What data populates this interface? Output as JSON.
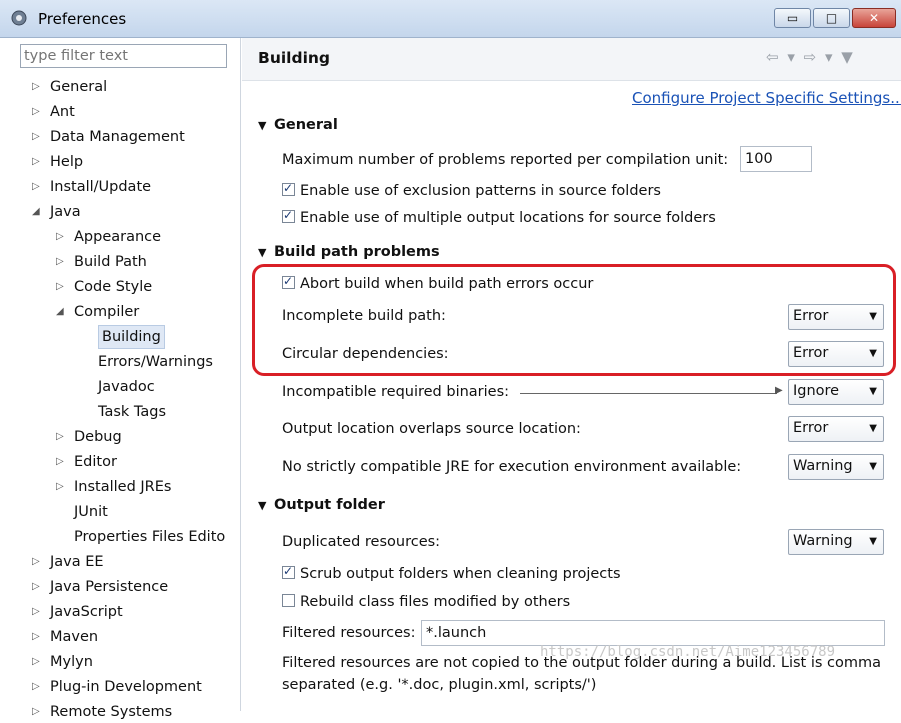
{
  "window": {
    "title": "Preferences",
    "min_glyph": "▭",
    "max_glyph": "□",
    "close_glyph": "✕"
  },
  "filter": {
    "placeholder": "type filter text"
  },
  "tree": {
    "items": [
      {
        "label": "General",
        "level": 0,
        "twisty": "▷"
      },
      {
        "label": "Ant",
        "level": 0,
        "twisty": "▷"
      },
      {
        "label": "Data Management",
        "level": 0,
        "twisty": "▷"
      },
      {
        "label": "Help",
        "level": 0,
        "twisty": "▷"
      },
      {
        "label": "Install/Update",
        "level": 0,
        "twisty": "▷"
      },
      {
        "label": "Java",
        "level": 0,
        "twisty": "◢"
      },
      {
        "label": "Appearance",
        "level": 1,
        "twisty": "▷"
      },
      {
        "label": "Build Path",
        "level": 1,
        "twisty": "▷"
      },
      {
        "label": "Code Style",
        "level": 1,
        "twisty": "▷"
      },
      {
        "label": "Compiler",
        "level": 1,
        "twisty": "◢"
      },
      {
        "label": "Building",
        "level": 2,
        "twisty": "",
        "selected": true
      },
      {
        "label": "Errors/Warnings",
        "level": 2,
        "twisty": ""
      },
      {
        "label": "Javadoc",
        "level": 2,
        "twisty": ""
      },
      {
        "label": "Task Tags",
        "level": 2,
        "twisty": ""
      },
      {
        "label": "Debug",
        "level": 1,
        "twisty": "▷"
      },
      {
        "label": "Editor",
        "level": 1,
        "twisty": "▷"
      },
      {
        "label": "Installed JREs",
        "level": 1,
        "twisty": "▷"
      },
      {
        "label": "JUnit",
        "level": 1,
        "twisty": ""
      },
      {
        "label": "Properties Files Edito",
        "level": 1,
        "twisty": ""
      },
      {
        "label": "Java EE",
        "level": 0,
        "twisty": "▷"
      },
      {
        "label": "Java Persistence",
        "level": 0,
        "twisty": "▷"
      },
      {
        "label": "JavaScript",
        "level": 0,
        "twisty": "▷"
      },
      {
        "label": "Maven",
        "level": 0,
        "twisty": "▷"
      },
      {
        "label": "Mylyn",
        "level": 0,
        "twisty": "▷"
      },
      {
        "label": "Plug-in Development",
        "level": 0,
        "twisty": "▷"
      },
      {
        "label": "Remote Systems",
        "level": 0,
        "twisty": "▷"
      }
    ]
  },
  "page": {
    "title": "Building",
    "nav_icons": "⇦ ▾ ⇨ ▾ ▼",
    "configure_link": "Configure Project Specific Settings...",
    "general": {
      "header": "General",
      "max_problems_label": "Maximum number of problems reported per compilation unit:",
      "max_problems_value": "100",
      "exclusion_label": "Enable use of exclusion patterns in source folders",
      "exclusion_checked": true,
      "multiple_output_label": "Enable use of multiple output locations for source folders",
      "multiple_output_checked": true
    },
    "build_path": {
      "header": "Build path problems",
      "abort_label": "Abort build when build path errors occur",
      "abort_checked": true,
      "incomplete_label": "Incomplete build path:",
      "incomplete_value": "Error",
      "circular_label": "Circular dependencies:",
      "circular_value": "Error",
      "incompatible_label": "Incompatible required binaries:",
      "incompatible_value": "Ignore",
      "overlap_label": "Output location overlaps source location:",
      "overlap_value": "Error",
      "jre_label": "No strictly compatible JRE for execution environment available:",
      "jre_value": "Warning"
    },
    "output": {
      "header": "Output folder",
      "duplicated_label": "Duplicated resources:",
      "duplicated_value": "Warning",
      "scrub_label": "Scrub output folders when cleaning projects",
      "scrub_checked": true,
      "rebuild_label": "Rebuild class files modified by others",
      "rebuild_checked": false,
      "filtered_label": "Filtered resources:",
      "filtered_value": "*.launch",
      "note": "Filtered resources are not copied to the output folder during a build. List is comma separated (e.g. '*.doc, plugin.xml, scripts/')"
    },
    "dropdown_glyph": "▼",
    "section_arrow": "▼",
    "watermark": "https://blog.csdn.net/Aime123456789"
  },
  "colors": {
    "highlight": "#d91f26",
    "link": "#1a52b6"
  }
}
